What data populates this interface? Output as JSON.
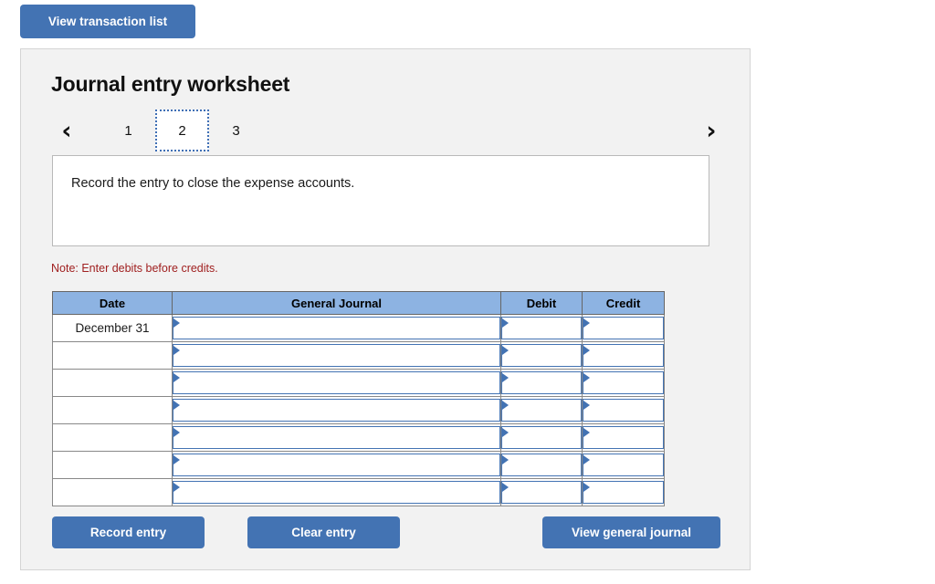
{
  "toolbar": {
    "view_transaction_list_label": "View transaction list"
  },
  "worksheet": {
    "title": "Journal entry worksheet",
    "pagination": {
      "prev_icon": "chevron-left-icon",
      "next_icon": "chevron-right-icon",
      "prev_glyph": "‹",
      "next_glyph": "›",
      "pages": [
        "1",
        "2",
        "3"
      ],
      "active_page": "2"
    },
    "instruction": "Record the entry to close the expense accounts.",
    "note": "Note: Enter debits before credits.",
    "table": {
      "columns": [
        "Date",
        "General Journal",
        "Debit",
        "Credit"
      ],
      "rows": [
        {
          "date": "December 31",
          "general_journal": "",
          "debit": "",
          "credit": ""
        },
        {
          "date": "",
          "general_journal": "",
          "debit": "",
          "credit": ""
        },
        {
          "date": "",
          "general_journal": "",
          "debit": "",
          "credit": ""
        },
        {
          "date": "",
          "general_journal": "",
          "debit": "",
          "credit": ""
        },
        {
          "date": "",
          "general_journal": "",
          "debit": "",
          "credit": ""
        },
        {
          "date": "",
          "general_journal": "",
          "debit": "",
          "credit": ""
        },
        {
          "date": "",
          "general_journal": "",
          "debit": "",
          "credit": ""
        }
      ]
    },
    "actions": {
      "record_entry_label": "Record entry",
      "clear_entry_label": "Clear entry",
      "view_general_journal_label": "View general journal"
    }
  },
  "colors": {
    "button_blue": "#4373b3",
    "table_header_blue": "#8db3e2",
    "panel_gray": "#f2f2f2",
    "note_red": "#a02020",
    "field_border_blue": "#4373b3"
  }
}
